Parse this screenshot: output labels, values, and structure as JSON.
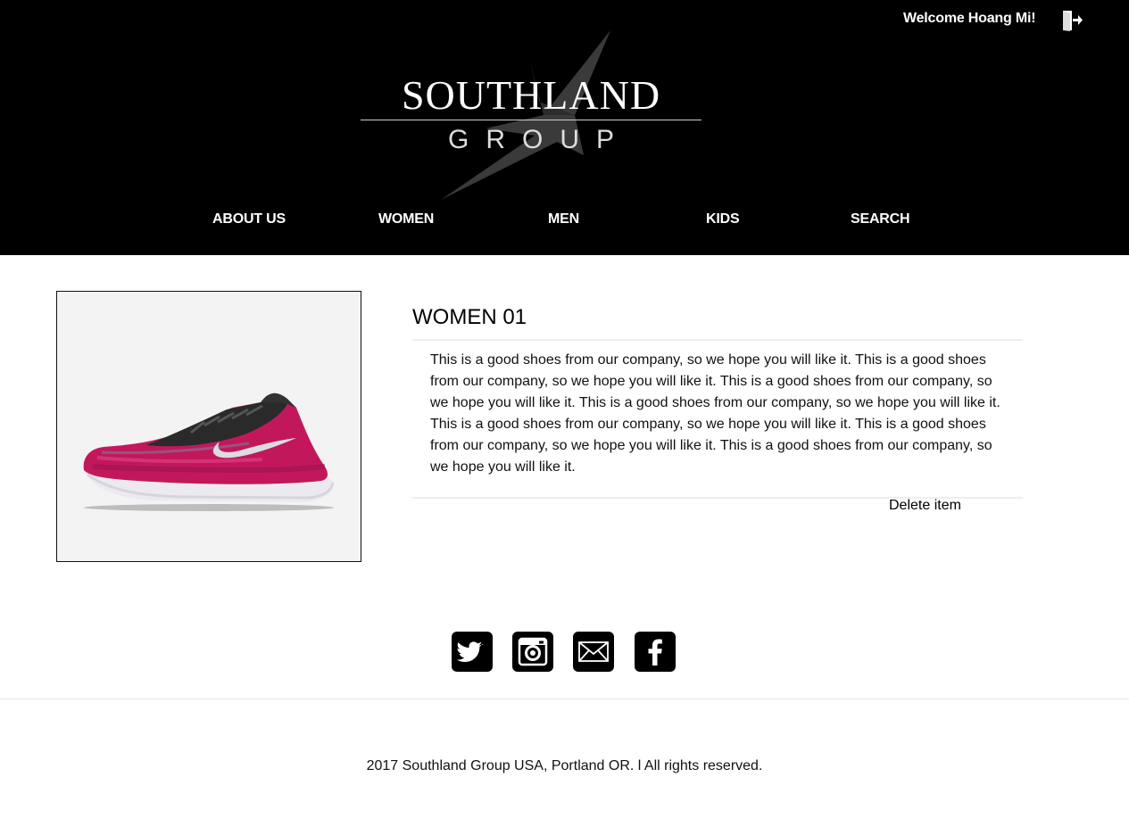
{
  "header": {
    "welcome": "Welcome Hoang Mi!",
    "logout_icon": "logout-icon",
    "logo_main": "SOUTHLAND",
    "logo_sub": "GROUP"
  },
  "nav": {
    "items": [
      "ABOUT US",
      "WOMEN",
      "MEN",
      "KIDS",
      "SEARCH"
    ]
  },
  "product": {
    "title": "WOMEN 01",
    "description": "This is a good shoes from our company, so we hope you will like it. This is a good shoes from our company, so we hope you will like it. This is a good shoes from our company, so we hope you will like it. This is a good shoes from our company, so we hope you will like it. This is a good shoes from our company, so we hope you will like it. This is a good shoes from our company, so we hope you will like it. This is a good shoes from our company, so we hope you will like it.",
    "delete_label": "Delete item",
    "image_icon": "sneaker-image",
    "colors": {
      "accent": "#c2185b",
      "upper": "#2a2a2a",
      "sole": "#e9e9ee"
    }
  },
  "social": {
    "icons": [
      "twitter-icon",
      "instagram-icon",
      "mail-icon",
      "facebook-icon"
    ]
  },
  "footer": {
    "copyright": "2017 Southland Group USA, Portland OR. l All rights reserved."
  }
}
